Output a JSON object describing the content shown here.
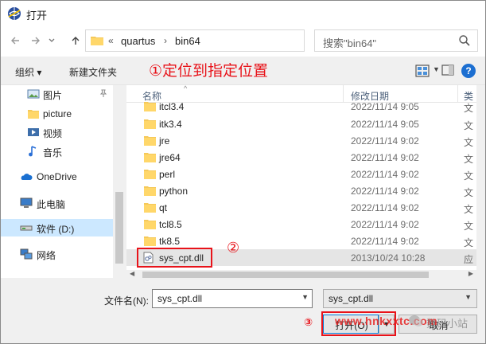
{
  "window": {
    "title": "打开",
    "accent": "#0078d7",
    "annotation_color": "#e8131a"
  },
  "nav": {
    "back_icon": "arrow-left-icon",
    "forward_icon": "arrow-right-icon",
    "recent_icon": "chevron-down-icon",
    "up_icon": "arrow-up-icon"
  },
  "address": {
    "overflow": "«",
    "segments": [
      "quartus",
      "bin64"
    ],
    "separator": "›"
  },
  "search": {
    "placeholder": "搜索\"bin64\""
  },
  "toolbar": {
    "organize": "组织 ▾",
    "new_folder": "新建文件夹",
    "annotation_1": "①定位到指定位置",
    "help": "?"
  },
  "sidebar": {
    "items": [
      {
        "label": "图片",
        "icon": "pictures-icon"
      },
      {
        "label": "picture",
        "icon": "folder-icon"
      },
      {
        "label": "视频",
        "icon": "video-icon"
      },
      {
        "label": "音乐",
        "icon": "music-icon"
      },
      {
        "label": "OneDrive",
        "icon": "cloud-icon"
      },
      {
        "label": "此电脑",
        "icon": "computer-icon"
      },
      {
        "label": "软件 (D:)",
        "icon": "drive-icon"
      },
      {
        "label": "网络",
        "icon": "network-icon"
      }
    ]
  },
  "filelist": {
    "columns": [
      "名称",
      "修改日期",
      "类"
    ],
    "rows": [
      {
        "name": "itcl3.4",
        "date": "2022/11/14 9:05",
        "type": "文"
      },
      {
        "name": "itk3.4",
        "date": "2022/11/14 9:05",
        "type": "文"
      },
      {
        "name": "jre",
        "date": "2022/11/14 9:02",
        "type": "文"
      },
      {
        "name": "jre64",
        "date": "2022/11/14 9:02",
        "type": "文"
      },
      {
        "name": "perl",
        "date": "2022/11/14 9:02",
        "type": "文"
      },
      {
        "name": "python",
        "date": "2022/11/14 9:02",
        "type": "文"
      },
      {
        "name": "qt",
        "date": "2022/11/14 9:02",
        "type": "文"
      },
      {
        "name": "tcl8.5",
        "date": "2022/11/14 9:02",
        "type": "文"
      },
      {
        "name": "tk8.5",
        "date": "2022/11/14 9:02",
        "type": "文"
      },
      {
        "name": "sys_cpt.dll",
        "date": "2013/10/24 10:28",
        "type": "应"
      }
    ],
    "annotation_2": "②"
  },
  "footer": {
    "filename_label": "文件名(N):",
    "filename_value": "sys_cpt.dll",
    "filetype_value": "sys_cpt.dll",
    "open_label": "打开(O)",
    "cancel_label": "取消",
    "annotation_3": "③"
  },
  "watermark": {
    "url": "www.hnkxxtc.com",
    "text2": "数码小站"
  }
}
